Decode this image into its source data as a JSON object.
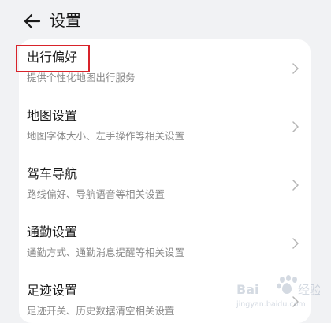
{
  "header": {
    "title": "设置",
    "back_icon": "arrow-left-icon"
  },
  "settings": [
    {
      "title": "出行偏好",
      "subtitle": "提供个性化地图出行服务"
    },
    {
      "title": "地图设置",
      "subtitle": "地图字体大小、左手操作等相关设置"
    },
    {
      "title": "驾车导航",
      "subtitle": "路线偏好、导航语音等相关设置"
    },
    {
      "title": "通勤设置",
      "subtitle": "通勤方式、通勤消息提醒等相关设置"
    },
    {
      "title": "足迹设置",
      "subtitle": "足迹开关、历史数据清空相关设置"
    }
  ],
  "chevron_icon": "chevron-right-icon",
  "watermark": {
    "text": "Baidu经验",
    "url": "jingyan.baidu.com"
  },
  "colors": {
    "background": "#f1f2f4",
    "card": "#ffffff",
    "title_text": "#1a1a1a",
    "subtitle_text": "#8a8a8a",
    "highlight": "#d8232a"
  }
}
